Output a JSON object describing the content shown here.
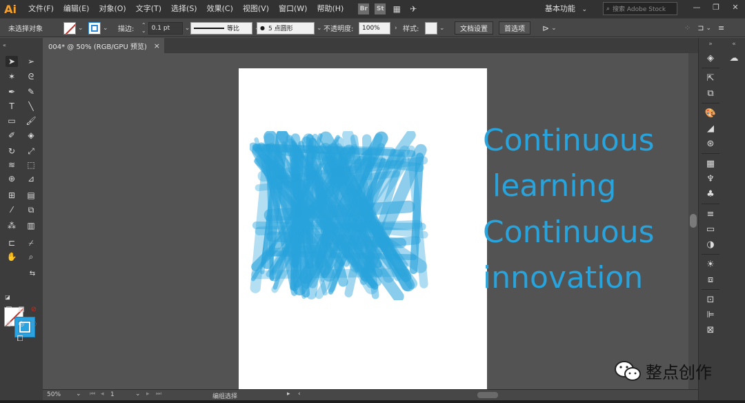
{
  "app": {
    "logo": "Ai",
    "menus": [
      "文件(F)",
      "编辑(E)",
      "对象(O)",
      "文字(T)",
      "选择(S)",
      "效果(C)",
      "视图(V)",
      "窗口(W)",
      "帮助(H)"
    ],
    "menu_icons": [
      "Br",
      "St"
    ],
    "workspace_label": "基本功能",
    "stock_search_placeholder": "搜索 Adobe Stock"
  },
  "control_bar": {
    "selection_label": "未选择对象",
    "stroke_label": "描边:",
    "stroke_weight": "0.1 pt",
    "profile_label": "等比",
    "brush_label": "5 点圆形",
    "opacity_label": "不透明度:",
    "opacity_value": "100%",
    "style_label": "样式:",
    "doc_setup_button": "文档设置",
    "preferences_button": "首选项"
  },
  "document": {
    "tab_title": "004* @ 50% (RGB/GPU 预览)",
    "tab_close": "×"
  },
  "artwork": {
    "text_lines": [
      "Continuous",
      " learning",
      "Continuous",
      "innovation"
    ],
    "text_color": "#29a3dc",
    "scribble_color": "#29a3dc"
  },
  "status_bar": {
    "zoom": "50%",
    "artboard_number": "1",
    "status_text": "编组选择"
  },
  "watermark": {
    "text": "整点创作"
  }
}
